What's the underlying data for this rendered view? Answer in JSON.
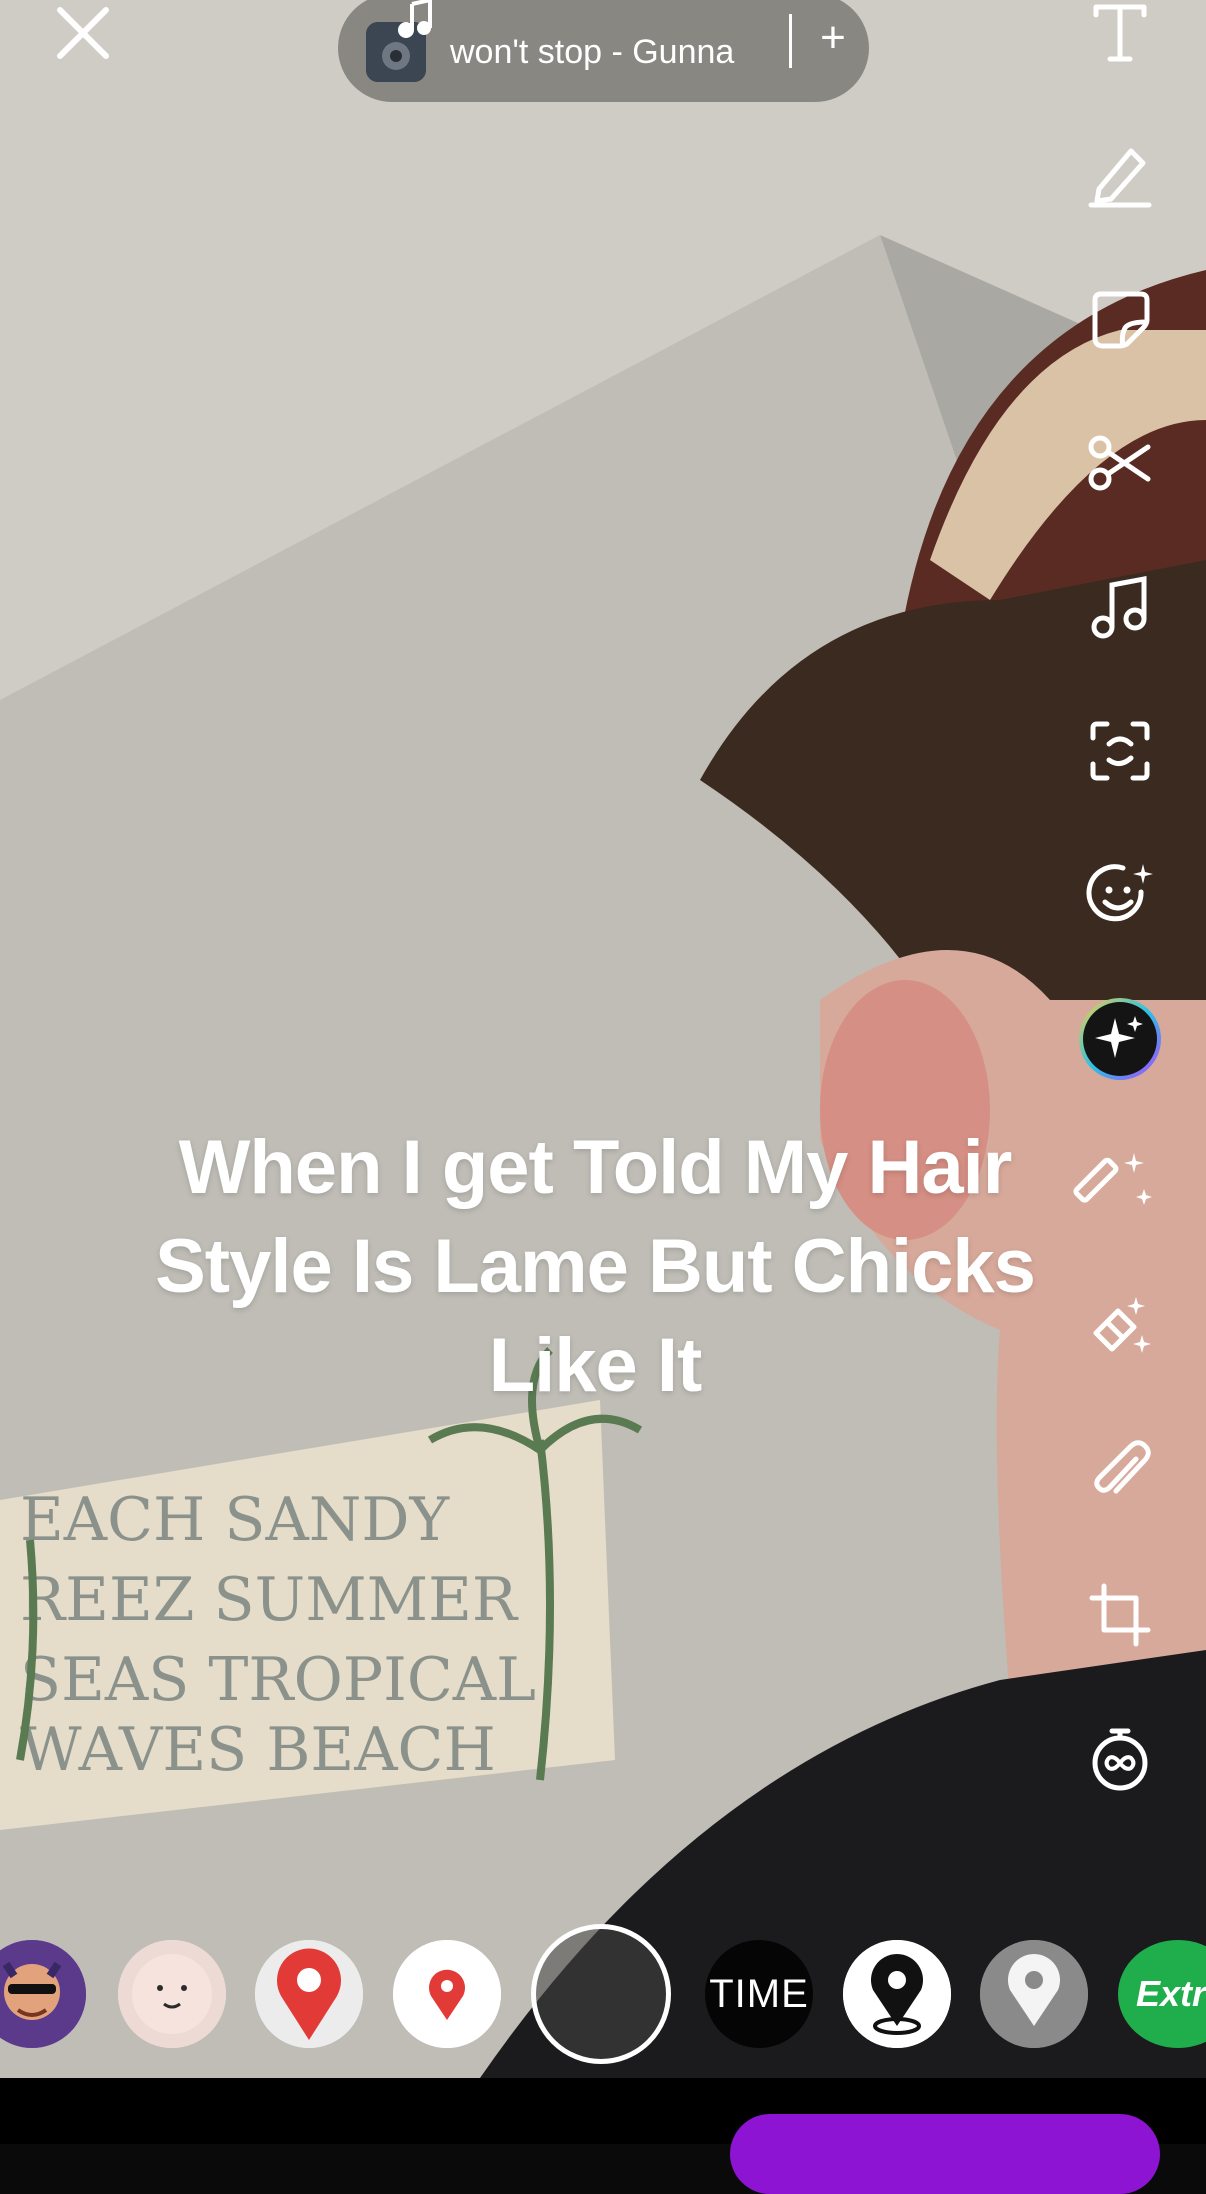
{
  "music": {
    "track": "won't stop - Gunna",
    "add_symbol": "+"
  },
  "caption": {
    "line1": "When I get Told My Hair",
    "line2": "Style Is Lame But Chicks",
    "line3": "Like It"
  },
  "toolbar": {
    "tools": [
      "text-tool",
      "draw-tool",
      "sticker-tool",
      "scissors-tool",
      "music-tool",
      "scan-tool",
      "lenses-tool",
      "ai-sparkle-tool",
      "magic-wand-tool",
      "eraser-tool",
      "attachment-tool",
      "crop-tool",
      "timer-tool"
    ]
  },
  "lenses": {
    "time_label": "TIME",
    "extra_label": "Extra"
  },
  "colors": {
    "accent_purple": "#8e14d4",
    "extra_green": "#1fae4b",
    "map_pin_red": "#e23a36"
  }
}
